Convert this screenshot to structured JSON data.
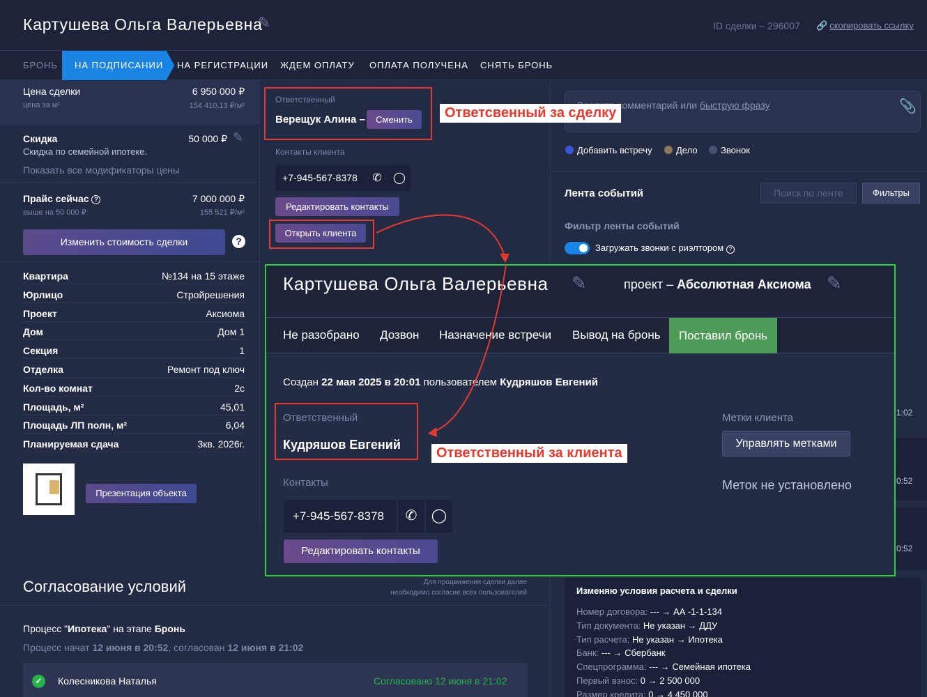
{
  "header": {
    "title": "Картушева Ольга Валерьевна",
    "deal_id": "ID сделки – 296007",
    "copy_link": "скопировать ссылку"
  },
  "tabs": [
    {
      "label": "БРОНЬ"
    },
    {
      "label": "НА ПОДПИСАНИИ"
    },
    {
      "label": "НА РЕГИСТРАЦИИ"
    },
    {
      "label": "ЖДЕМ ОПЛАТУ"
    },
    {
      "label": "ОПЛАТА ПОЛУЧЕНА"
    },
    {
      "label": "СНЯТЬ БРОНЬ"
    }
  ],
  "pricing": {
    "price_label": "Цена сделки",
    "price_value": "6 950 000 ₽",
    "per_m2_label": "цена за м²",
    "per_m2_value": "154 410,13 ₽/м²",
    "discount_label": "Скидка",
    "discount_value": "50 000 ₽",
    "discount_note": "Скидка по семейной ипотеке.",
    "modifiers_link": "Показать все модификаторы цены",
    "current_price_label": "Прайс сейчас",
    "current_price_value": "7 000 000 ₽",
    "current_price_sub": "выше на 50 000 ₽",
    "current_per_m2": "155 521 ₽/м²",
    "change_button": "Изменить стоимость сделки"
  },
  "properties": [
    {
      "k": "Квартира",
      "v": "№134 на 15 этаже"
    },
    {
      "k": "Юрлицо",
      "v": "Стройрешения"
    },
    {
      "k": "Проект",
      "v": "Аксиома"
    },
    {
      "k": "Дом",
      "v": "Дом 1"
    },
    {
      "k": "Секция",
      "v": "1"
    },
    {
      "k": "Отделка",
      "v": "Ремонт под ключ"
    },
    {
      "k": "Кол-во комнат",
      "v": "2с"
    },
    {
      "k": "Площадь, м²",
      "v": "45,01"
    },
    {
      "k": "Площадь ЛП полн, м²",
      "v": "6,04"
    },
    {
      "k": "Планируемая сдача",
      "v": "3кв. 2026г."
    }
  ],
  "presentation_button": "Презентация объекта",
  "responsible": {
    "label": "Ответственный",
    "name": "Верещук Алина –",
    "change_button": "Сменить"
  },
  "contacts": {
    "label": "Контакты клиента",
    "phone": "+7-945-567-8378",
    "edit_button": "Редактировать контакты",
    "open_client_button": "Открыть клиента"
  },
  "comment": {
    "placeholder_start": "Введите комментарий или ",
    "placeholder_link": "быструю фразу"
  },
  "activity": {
    "meeting": "Добавить встречу",
    "task": "Дело",
    "call": "Звонок"
  },
  "feed": {
    "title": "Лента событий",
    "search_placeholder": "Поиск по ленте",
    "filters_button": "Фильтры",
    "filter_label": "Фильтр ленты событий",
    "load_calls": "Загружать звонки с риэлтором",
    "times": [
      "1:02",
      "0:52",
      "0:52"
    ],
    "card_title": "Изменяю условия расчета и сделки",
    "card_lines": [
      {
        "k": "Номер договора:",
        "v": " --- → АА -1-1-134"
      },
      {
        "k": "Тип документа:",
        "v": " Не указан → ДДУ"
      },
      {
        "k": "Тип расчета:",
        "v": " Не указан → Ипотека"
      },
      {
        "k": "Банк:",
        "v": " --- → Сбербанк"
      },
      {
        "k": "Спецпрограмма:",
        "v": " --- → Семейная ипотека"
      },
      {
        "k": "Первый взнос:",
        "v": " 0 → 2 500 000"
      },
      {
        "k": "Размер кредита:",
        "v": " 0 → 4 450 000"
      }
    ]
  },
  "agreement": {
    "title": "Согласование условий",
    "hint_line1": "Для продвижения сделки далее",
    "hint_line2": "необходимо согласие всех пользователей",
    "process_prefix": "Процесс \"",
    "process_name": "Ипотека",
    "process_mid": "\" на этапе ",
    "process_stage": "Бронь",
    "started_prefix": "Процесс начат ",
    "started_at": "12 июня в 20:52",
    "agreed_prefix": ", согласован ",
    "agreed_at": "12 июня в 21:02",
    "approver_name": "Колесникова Наталья",
    "approver_status": "Согласовано 12 июня в 21:02"
  },
  "client_popup": {
    "title": "Картушева Ольга Валерьевна",
    "project_prefix": "проект – ",
    "project_name": "Абсолютная Аксиома",
    "tabs": [
      "Не разобрано",
      "Дозвон",
      "Назначение встречи",
      "Вывод на бронь"
    ],
    "active_tab": "Поставил бронь",
    "created_prefix": "Создан ",
    "created_at": "22 мая 2025 в 20:01",
    "created_mid": " пользователем ",
    "created_by": "Кудряшов Евгений",
    "responsible_label": "Ответственный",
    "responsible_name": "Кудряшов Евгений",
    "tags_label": "Метки клиента",
    "tags_button": "Управлять метками",
    "no_tags": "Меток не установлено",
    "contacts_label": "Контакты",
    "phone": "+7-945-567-8378",
    "edit_button": "Редактировать контакты"
  },
  "annotations": {
    "deal_responsible": "Ответсвенный за сделку",
    "client_responsible": "Ответственный за клиента"
  },
  "colors": {
    "accent_blue": "#1a84e4",
    "active_green": "#4e9a57",
    "highlight_green": "#2fd13a",
    "annotation_red": "#e53b2f",
    "approved_green": "#26b34a"
  }
}
